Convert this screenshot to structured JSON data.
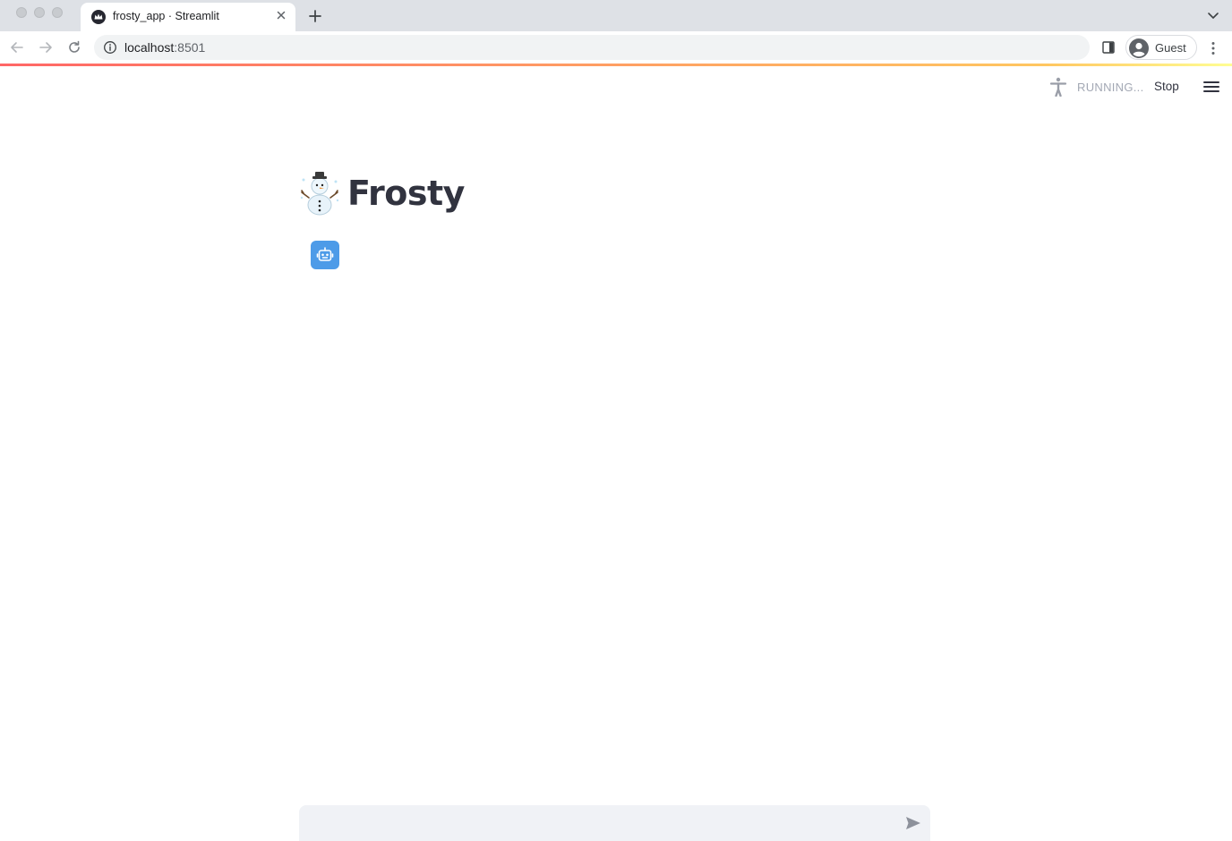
{
  "browser": {
    "tab_title": "frosty_app · Streamlit",
    "url_host": "localhost",
    "url_port": ":8501",
    "profile_name": "Guest",
    "favicon": "streamlit-crown-icon"
  },
  "header": {
    "status_label": "RUNNING...",
    "stop_label": "Stop",
    "running_icon": "running-person-icon",
    "menu_icon": "hamburger-menu-icon"
  },
  "app": {
    "title_emoji": "snowman-emoji",
    "title": "Frosty",
    "assistant_avatar": "robot-icon"
  },
  "chat_input": {
    "value": "",
    "placeholder": "",
    "send_icon": "send-arrow-icon"
  },
  "colors": {
    "accent_red": "#ff4b4b",
    "avatar_blue": "#4d9be8",
    "text": "#31333f",
    "muted": "#a3a8b4",
    "input_bg": "#f0f2f6"
  }
}
